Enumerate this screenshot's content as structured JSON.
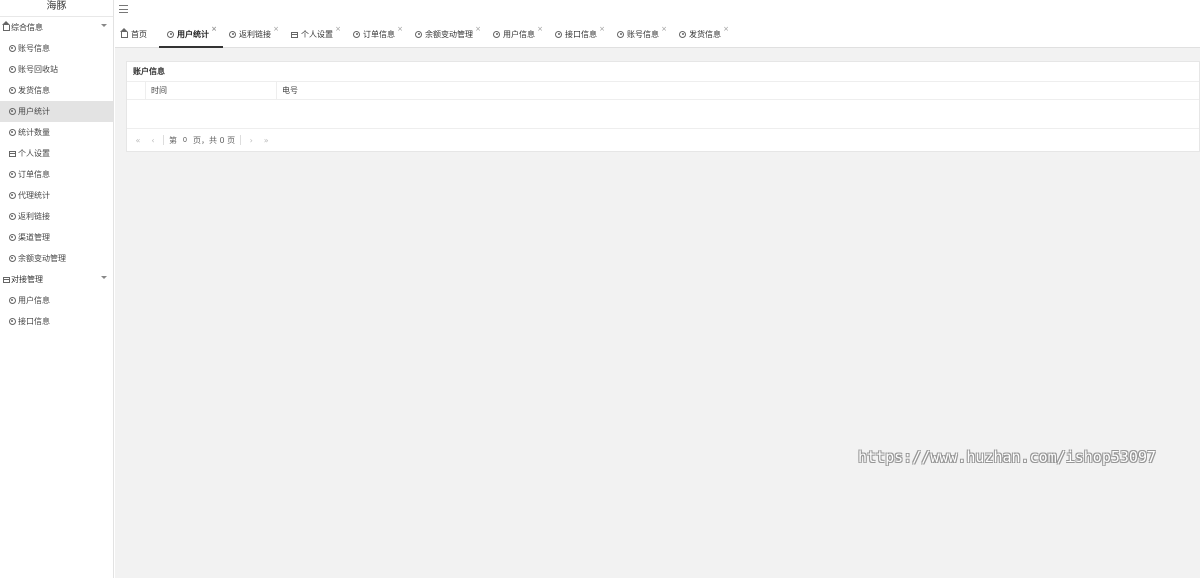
{
  "sidebar": {
    "logo": "海豚",
    "groups": [
      {
        "label": "综合信息",
        "icon": "home-icon",
        "items": [
          {
            "label": "账号信息",
            "icon": "user-circle-icon"
          },
          {
            "label": "账号回收站",
            "icon": "user-circle-icon"
          },
          {
            "label": "发货信息",
            "icon": "user-circle-icon"
          },
          {
            "label": "用户统计",
            "icon": "user-circle-icon",
            "active": true
          },
          {
            "label": "统计数量",
            "icon": "user-circle-icon"
          },
          {
            "label": "个人设置",
            "icon": "table-icon"
          },
          {
            "label": "订单信息",
            "icon": "user-circle-icon"
          },
          {
            "label": "代理统计",
            "icon": "user-circle-icon"
          },
          {
            "label": "返利链接",
            "icon": "user-circle-icon"
          },
          {
            "label": "渠道管理",
            "icon": "user-circle-icon"
          },
          {
            "label": "余额变动管理",
            "icon": "user-circle-icon"
          }
        ]
      },
      {
        "label": "对接管理",
        "icon": "table-icon",
        "items": [
          {
            "label": "用户信息",
            "icon": "user-circle-icon"
          },
          {
            "label": "接口信息",
            "icon": "user-circle-icon"
          }
        ]
      }
    ]
  },
  "tabs": [
    {
      "label": "首页",
      "icon": "home-icon",
      "closable": false
    },
    {
      "label": "用户统计",
      "icon": "user-circle-icon",
      "closable": true,
      "active": true
    },
    {
      "label": "返利链接",
      "icon": "user-circle-icon",
      "closable": true
    },
    {
      "label": "个人设置",
      "icon": "table-icon",
      "closable": true
    },
    {
      "label": "订单信息",
      "icon": "user-circle-icon",
      "closable": true
    },
    {
      "label": "余额变动管理",
      "icon": "user-circle-icon",
      "closable": true
    },
    {
      "label": "用户信息",
      "icon": "user-circle-icon",
      "closable": true
    },
    {
      "label": "接口信息",
      "icon": "user-circle-icon",
      "closable": true
    },
    {
      "label": "账号信息",
      "icon": "user-circle-icon",
      "closable": true
    },
    {
      "label": "发货信息",
      "icon": "user-circle-icon",
      "closable": true
    }
  ],
  "close_glyph": "×",
  "panel": {
    "title": "账户信息",
    "columns": [
      "时间",
      "电号"
    ]
  },
  "pager": {
    "first": "«",
    "prev": "‹",
    "page_prefix": "第",
    "page_value": "0",
    "page_suffix": "页，共 0 页",
    "next": "›",
    "last": "»"
  },
  "watermark": "https://www.huzhan.com/ishop53097"
}
